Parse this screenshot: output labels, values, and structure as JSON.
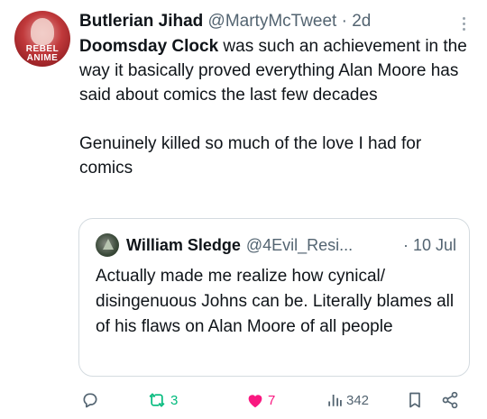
{
  "author": {
    "name": "Butlerian Jihad",
    "handle": "@MartyMcTweet",
    "separator": "·",
    "age": "2d",
    "avatar_text": "REBEL ANIME"
  },
  "tweet": {
    "bold_lead": "Doomsday Clock",
    "line1_rest": " was such an achievement in the way it basically proved everything Alan Moore has said about comics the last few decades",
    "paragraph2": "Genuinely killed so much of the love I had for comics"
  },
  "quote": {
    "name": "William Sledge",
    "handle": "@4Evil_Resi...",
    "date": "· 10 Jul",
    "text": "Actually made me realize how cynical/ disingenuous Johns can be. Literally blames all of his flaws on Alan Moore of all people"
  },
  "actions": {
    "retweets": "3",
    "likes": "7",
    "views": "342"
  },
  "colors": {
    "retweet": "#00ba7c",
    "like": "#f91880",
    "muted": "#536471"
  },
  "icons": [
    "reply-icon",
    "retweet-icon",
    "like-icon",
    "views-icon",
    "bookmark-icon",
    "share-icon",
    "more-icon"
  ]
}
